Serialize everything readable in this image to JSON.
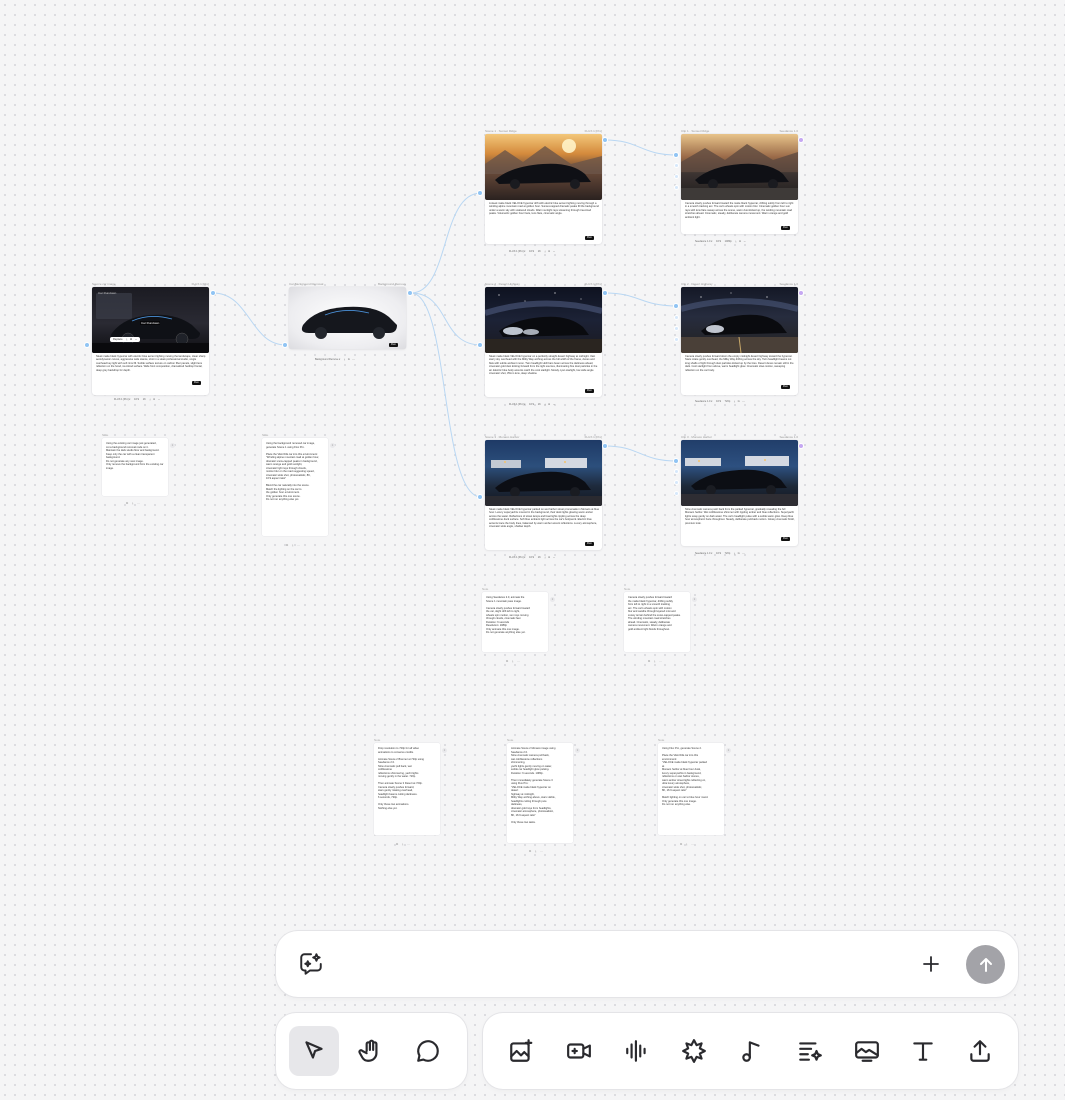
{
  "canvas": {
    "source_card": {
      "header_left": "Source car image",
      "header_right": "FLUX.1 [Pro]",
      "overlay_title": "Car Rundown",
      "overlay_badge": "Car Rundown",
      "action_replace": "Replace",
      "description": "Sleek matte black hypercar with electric blue accent lighting moving the landscape, clean sharp aerodynamic curves, aggressive wide stance, shot in a sleek professional studio, single overhead key light with soft rims fill. Subtle surface texture on carbon fiber panels, slight lens reflection on the hood, ice-blood surface. Wide front composition, dramatized hardtop frontal, deep grey backdrop for depth.",
      "run_label": "Run",
      "model": "FLUX.1 [Pro]",
      "res": "16:9",
      "count": "1K"
    },
    "bgremove_card": {
      "header_left": "Car Background Removal",
      "header_right": "Background Remove",
      "action": "Background Remove",
      "run_label": "Run"
    },
    "scene_cards": [
      {
        "header_left": "Scene 1 · Sunset Ridge",
        "header_right": "FLUX.1 [Pro]",
        "description": "A sleek matte black VELOCE hypercar drift with electric blue accent lighting moving through a winding alpine mountain road at golden hour. Sunset-capped dramatic peaks fill the background under a warm sky with scattered clouds. Warm sunlight rays streaming through tree-lined peaks. Volumetric golden hour haze, lens flare, cinematic angle.",
        "run_label": "Run",
        "model": "FLUX.1 [Pro]",
        "res": "16:9",
        "count": "1K"
      },
      {
        "header_left": "Scene 2 · Desert Highway",
        "header_right": "FLUX.1 [Pro]",
        "description": "Sleek matte black VELOCE hypercar on a perfectly straight desert highway at midnight. Vast starry sky overhead with the Milky Way arching across the full width of the frame, dunes and flats with subtle ambient moon. Twin headlight LED bars beam across the darkness ahead, cinematic gold dust kicking forward from the tight sources, illuminating fine dust particles in the air. Electric blue body accents catch the cool starlight. Moody cyan starlight, low wide angle cinematic shot, 35mm lens, deep shadow.",
        "run_label": "Run",
        "model": "FLUX.1 [Pro]",
        "res": "16:9",
        "count": "1K"
      },
      {
        "header_left": "Scene 3 · Monaco Harbor",
        "header_right": "FLUX.1 [Pro]",
        "description": "Sleek matte black VELOCE hypercar parked on wet harbor street promenade in Monaco at blue hour. Luxury superyachts moored in the background, their deck lights glowing warm amber across the water. Reflections of street lamps and boat lights rippling across the deep cobblestone dock surface. Soft blue ambient light across the car's bodywork. Electric blue accents trace the body lines, balanced by warm amber accent reflections. Luxury atmosphere, cinematic wide angle, shallow depth.",
        "run_label": "Run",
        "model": "FLUX.1 [Pro]",
        "res": "16:9",
        "count": "1K"
      }
    ],
    "video_cards": [
      {
        "header_left": "Clip 1 · Sunset Ridge",
        "header_right": "Seedance 1.0",
        "description": "Camera slowly pushes forward toward the matte black hypercar, drifting subtly from left to right in a smooth tracking arc. The car's wheels spin with motion blur. Cinematic golden hour sun rays with lens flare sweep across the scene, warm dust kicked up, the winding mountain road stretches ahead. Cinematic, steady, deliberate camera movement. Warm orange and gold ambient light.",
        "run_label": "Run",
        "model": "Seedance 1.0",
        "res": "16:9",
        "count": "1080p"
      },
      {
        "header_left": "Clip 2 · Desert Highway",
        "header_right": "Seedance 1.0",
        "description": "Camera slowly pushes forward down the empty midnight desert highway toward the hypercar. Stars rotate gently overhead, the Milky Way drifting across the sky. Twin headlight beams cut long shafts of light through dust particles kicked up by the tires. Desert dunes remain still in the dark. Cool starlight from above, warm headlight glow. Cinematic slow-motion, sweeping reflection on the car body.",
        "run_label": "Run",
        "model": "Seedance 1.0",
        "res": "16:9",
        "count": "720p"
      },
      {
        "header_left": "Clip 3 · Monaco Harbor",
        "header_right": "Seedance 1.0",
        "description": "Slow cinematic camera push back from the parked hypercar, gradually revealing the full Monaco harbor. Wet cobblestone shimmer with rippling amber and blue reflections. Superyacht lights sway gently on dark water. The car's headlight pulse with a subtle warm glow. Deep blue hour atmospheric haze throughout. Steady, deliberate pull-back motion. Glossy cinematic finish, premium look.",
        "run_label": "Run",
        "model": "Seedance 1.0",
        "res": "16:9",
        "count": "720p"
      }
    ],
    "notes": [
      {
        "label": "Note",
        "text": "Using the existing car image just generated,\ncut a background removal node on it.\nMaintain the dark studio floor and background.\nKeep only the car with a clean transparent background.\nDo not generate any new image.\nOnly remove the background from the existing car image."
      },
      {
        "label": "Note",
        "text": "Using the background removed car image,\ngenerate Scene 1 using Flux Pro.\n\nPlace the VELOCE car into this environment:\n\"Winding alpine mountain road at golden hour,\ndramatic snow-capped peaks in background,\nwarm orange and gold sunlight,\ncinematic light rays through clouds,\nmotion blur on the road suggesting speed,\ncinematic wide shot, photorealistic, 8K,\n16:9 aspect ratio\"\n\nBlend the car naturally into the scene.\nMatch the lighting on the car to\nthe golden hour environment.\nOnly generate this one scene.\nDo not run anything else yet."
      },
      {
        "label": "Note",
        "text": "Using Seedance 2.0, animate the\nScene 1 mountain pass image.\n\nCamera slowly pushes forward toward\nthe car, slight drift left to right,\nwheels spin motion, sun rays moving\nthrough clouds, cinematic feel.\nDuration: 6 seconds\nResolution: 1080p\nOnly animate this one image.\nDo not generate anything else yet."
      },
      {
        "label": "Note",
        "text": "Camera slowly pushes forward toward\nthe matte black hypercar, drifting subtly\nfrom left to right in a smooth tracking\narc. The car's wheels spin with motion\nblur and swathe through layered mist and\nsnowy terrain behind the snow-capped peaks.\nThe winding mountain road stretches\nahead. Cinematic, steady, deliberate\ncamera movement. Warm orange and\ngold ambient light floods throughout."
      },
      {
        "label": "Note",
        "text": "Drop resolution to 720p for all video\nanimations to conserve credits.\n\nAnimate Scene 2 Brenner at 720p using\nSeedance 2.0.\nSlow cinematic pull back, wet\ncobblestone\nreflections shimmering, yacht lights\nmoving gently in the water. 720p.\n\nThen animate Scene 3 Desert at 720p.\nCamera slowly pushes forward,\nstars gently rotating overhead,\nheadlight beams cutting darkness.\n6 seconds, 720p.\n\nOnly these two animations.\nNothing else yet."
      },
      {
        "label": "Note",
        "text": "Animate Scene 2 Monaco image using\nSeedance 2.0.\nSlow cinematic camera pull back,\nwet cobblestone reflections\nshimmering,\nyacht lights gently moving on water,\nsubtle car headlight glow pulsing.\nDuration: 6 seconds. 1080p.\n\nThen immediately generate Scene 3\nusing Flux Pro:\n\"VELOCE matte black hypercar on\ndesert\nhighway at midnight,\nMilky Way arching above, stars visible,\nheadlights cutting through pure\ndarkness,\ndramatic gold rays from headlights,\ncinematic atmosphere, photorealistic,\n8K, 16:9 aspect ratio\"\n\nOnly these two tasks."
      },
      {
        "label": "Note",
        "text": "Using Flux Pro, generate Scene 2.\n\nPlace the VELOCE car into this\nenvironment:\n\"VELOCE matte black hypercar parked\nat\nMonaco harbor at blue hour dusk,\nluxury superyachts in background,\nreflections on wet harbor stones,\nwarm amber street lights reflecting on,\nultra luxury atmosphere,\ncinematic wide shot, photorealistic,\n8K, 16:9 aspect ratio\"\n\nMatch lighting on car to blue hour mood.\nOnly generate this one image.\nDo not run anything else."
      }
    ]
  },
  "prompt_bar": {
    "placeholder": "",
    "value": "",
    "add_icon": "plus-icon",
    "send_icon": "arrow-up-icon",
    "chat_icon": "chat-sparkle-icon"
  },
  "toolbar": {
    "left_tools": [
      "pointer-icon",
      "hand-icon",
      "comment-icon"
    ],
    "right_tools": [
      "image-generate-icon",
      "video-generate-icon",
      "audio-wave-icon",
      "enhance-icon",
      "music-icon",
      "text-sparkle-icon",
      "image-edit-icon",
      "text-icon",
      "upload-icon"
    ]
  },
  "colors": {
    "canvas_bg": "#f5f5f6",
    "edge": "#a9cdef",
    "port_blue": "#90c4f4",
    "port_purple": "#c6a8f2",
    "send_button": "#a3a3a8",
    "active_tool_bg": "#e7e7ea"
  }
}
